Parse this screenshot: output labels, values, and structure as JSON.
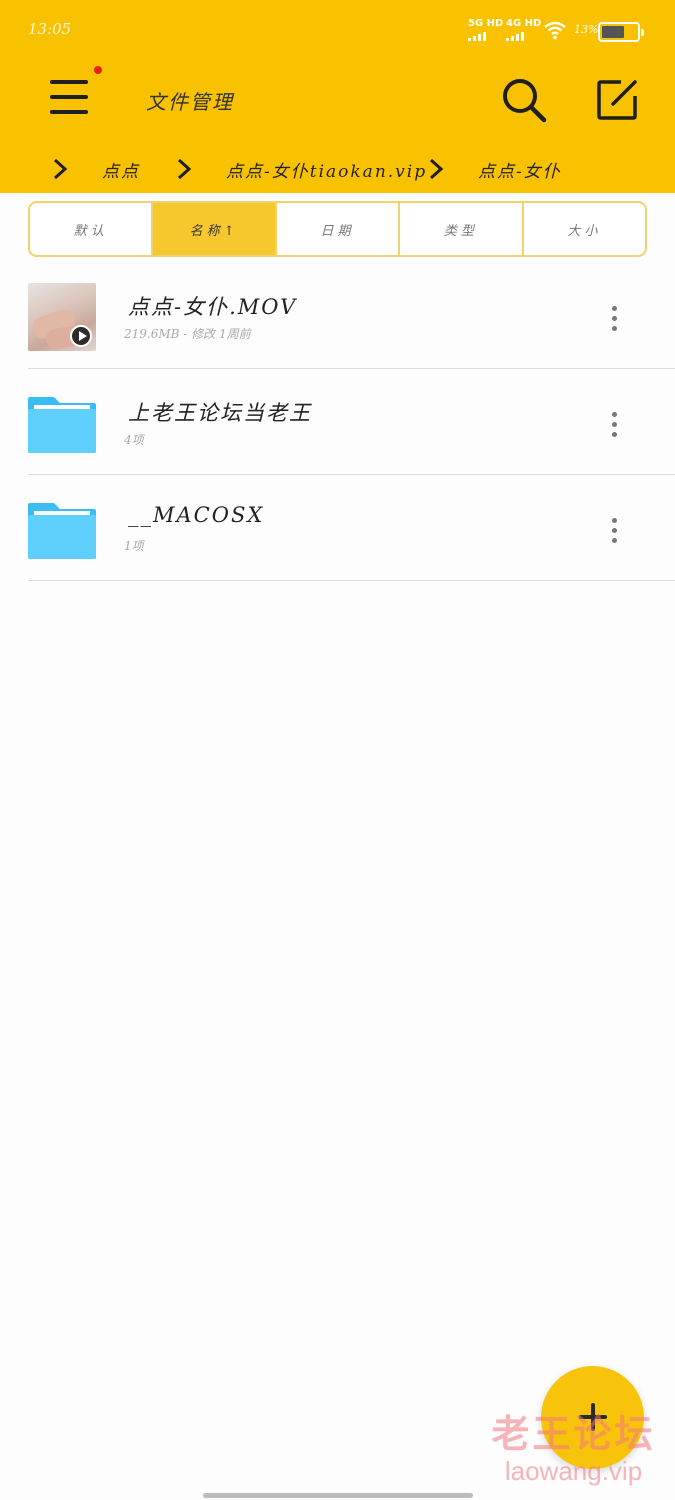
{
  "status_bar": {
    "time": "13:05",
    "network_1": "5G HD",
    "network_2": "4G HD",
    "battery_percent": "13%",
    "battery_level": 0.13
  },
  "header": {
    "title": "文件管理",
    "background_color": "#f9c200"
  },
  "breadcrumb": {
    "items": [
      "点点",
      "点点-女仆tiaokan.vip",
      "点点-女仆"
    ]
  },
  "sort_tabs": [
    {
      "label": "默认",
      "active": false
    },
    {
      "label": "名称↑",
      "active": true
    },
    {
      "label": "日期",
      "active": false
    },
    {
      "label": "类型",
      "active": false
    },
    {
      "label": "大小",
      "active": false
    }
  ],
  "files": [
    {
      "name": "点点-女仆.MOV",
      "meta": "219.6MB - 修改 1周前",
      "type": "video-thumbnail"
    },
    {
      "name": "上老王论坛当老王",
      "meta": "4项",
      "type": "folder-icon"
    },
    {
      "name": "__MACOSX",
      "meta": "1项",
      "type": "folder-icon"
    }
  ],
  "fab": {
    "icon": "plus-icon"
  },
  "watermark": {
    "line1": "老王论坛",
    "line2": "laowang.vip"
  }
}
